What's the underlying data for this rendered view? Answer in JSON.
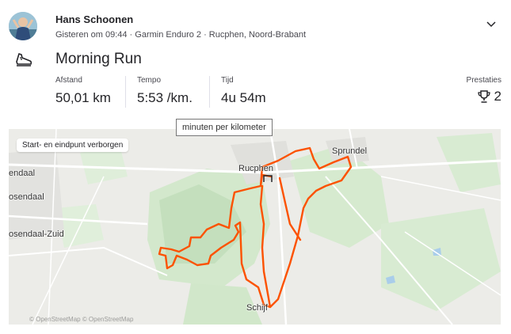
{
  "athlete": {
    "name": "Hans Schoonen",
    "meta": "Gisteren om 09:44 · Garmin Enduro 2 · Rucphen, Noord-Brabant"
  },
  "activity": {
    "title": "Morning Run",
    "sport_icon": "running-shoe-icon"
  },
  "stats": {
    "distance_label": "Afstand",
    "distance_value": "50,01 km",
    "pace_label": "Tempo",
    "pace_value": "5:53 /km.",
    "time_label": "Tijd",
    "time_value": "4u 54m",
    "achievements_label": "Prestaties",
    "achievements_count": "2"
  },
  "tooltip": "minuten per kilometer",
  "map": {
    "privacy_badge": "Start- en eindpunt verborgen",
    "attribution": "© OpenStreetMap © OpenStreetMap",
    "labels": {
      "rucphen": "Rucphen",
      "sprundel": "Sprundel",
      "schijf": "Schijf",
      "endaal": "endaal",
      "osendaal": "osendaal",
      "osendaal_zuid": "osendaal-Zuid"
    },
    "route_color": "#fc5200",
    "forest_color": "#c9e3c3",
    "field_color": "#dbeed6"
  }
}
